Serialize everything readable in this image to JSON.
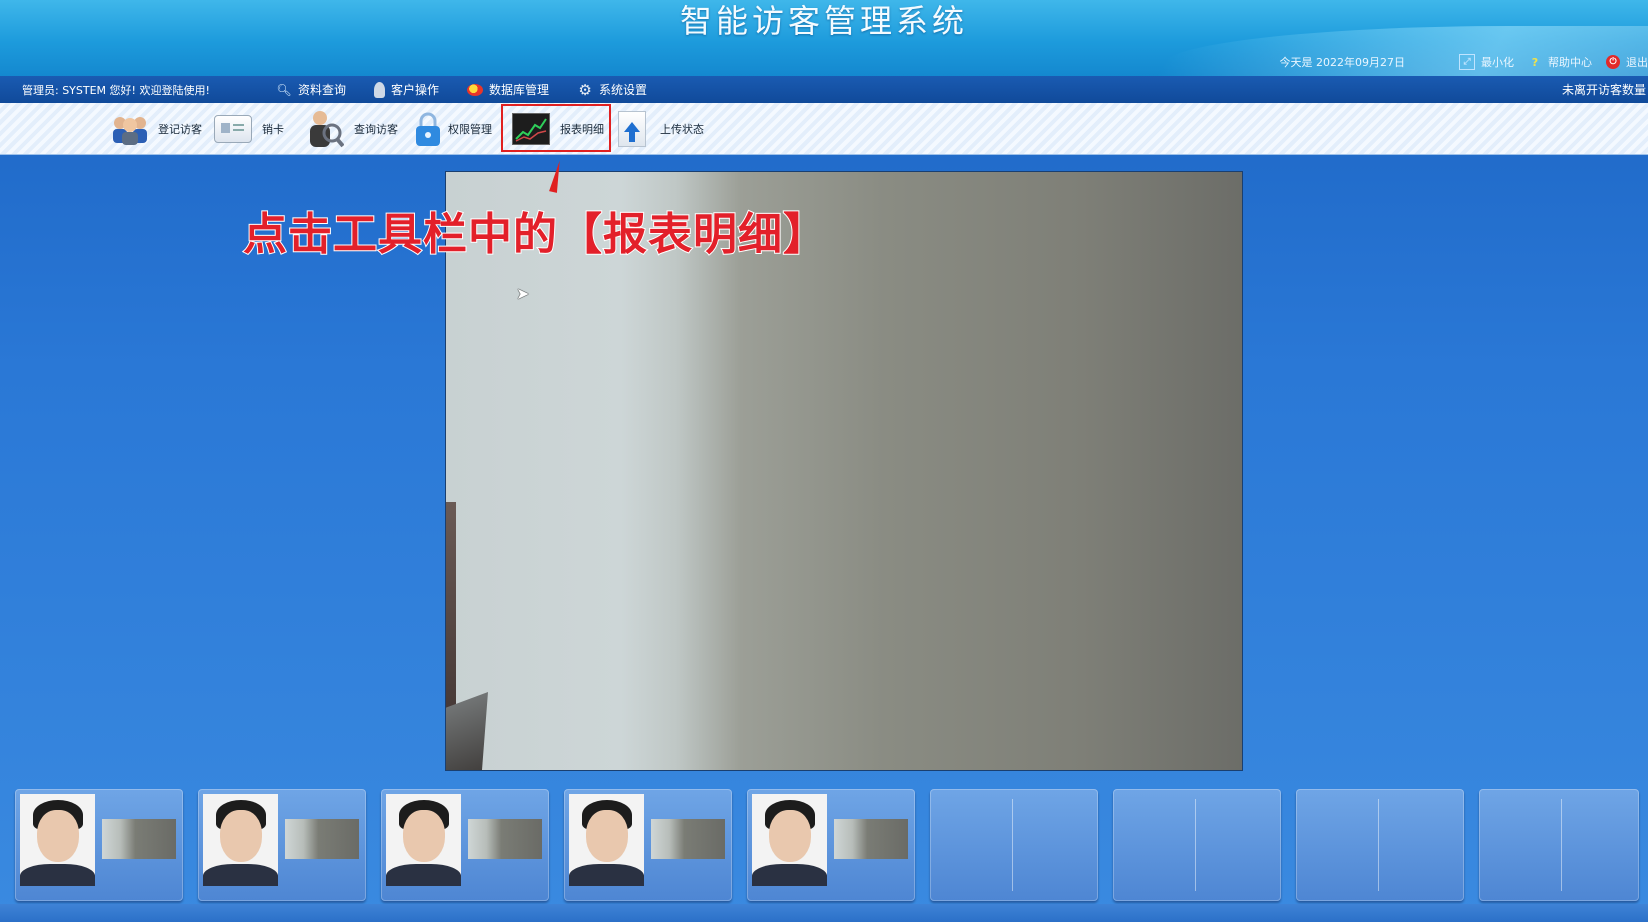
{
  "app": {
    "title": "智能访客管理系统",
    "date": "今天是 2022年09月27日",
    "minimize_label": "最小化",
    "help_label": "帮助中心",
    "exit_label": "退出"
  },
  "menubar": {
    "admin_greeting": "管理员: SYSTEM 您好! 欢迎登陆使用!",
    "items": [
      {
        "label": "资料查询",
        "icon": "search-icon"
      },
      {
        "label": "客户操作",
        "icon": "user-icon"
      },
      {
        "label": "数据库管理",
        "icon": "database-icon"
      },
      {
        "label": "系统设置",
        "icon": "gear-icon"
      }
    ],
    "visitors_label": "未离开访客数量"
  },
  "toolbar": {
    "items": [
      {
        "label": "登记访客",
        "icon": "register-visitor-icon"
      },
      {
        "label": "销卡",
        "icon": "card-icon"
      },
      {
        "label": "查询访客",
        "icon": "query-visitor-icon"
      },
      {
        "label": "权限管理",
        "icon": "lock-icon"
      },
      {
        "label": "报表明细",
        "icon": "report-chart-icon",
        "highlighted": true
      },
      {
        "label": "上传状态",
        "icon": "upload-icon"
      }
    ]
  },
  "annotation": {
    "text": "点击工具栏中的【报表明细】",
    "color": "#e3202a"
  },
  "thumbnails": [
    {
      "filled": true
    },
    {
      "filled": true
    },
    {
      "filled": true
    },
    {
      "filled": true
    },
    {
      "filled": true
    },
    {
      "filled": false
    },
    {
      "filled": false
    },
    {
      "filled": false
    },
    {
      "filled": false
    }
  ],
  "colors": {
    "titlebar": "#1d9bdc",
    "menubar": "#104a9a",
    "highlight": "#e02020",
    "background": "#2a78d6"
  }
}
